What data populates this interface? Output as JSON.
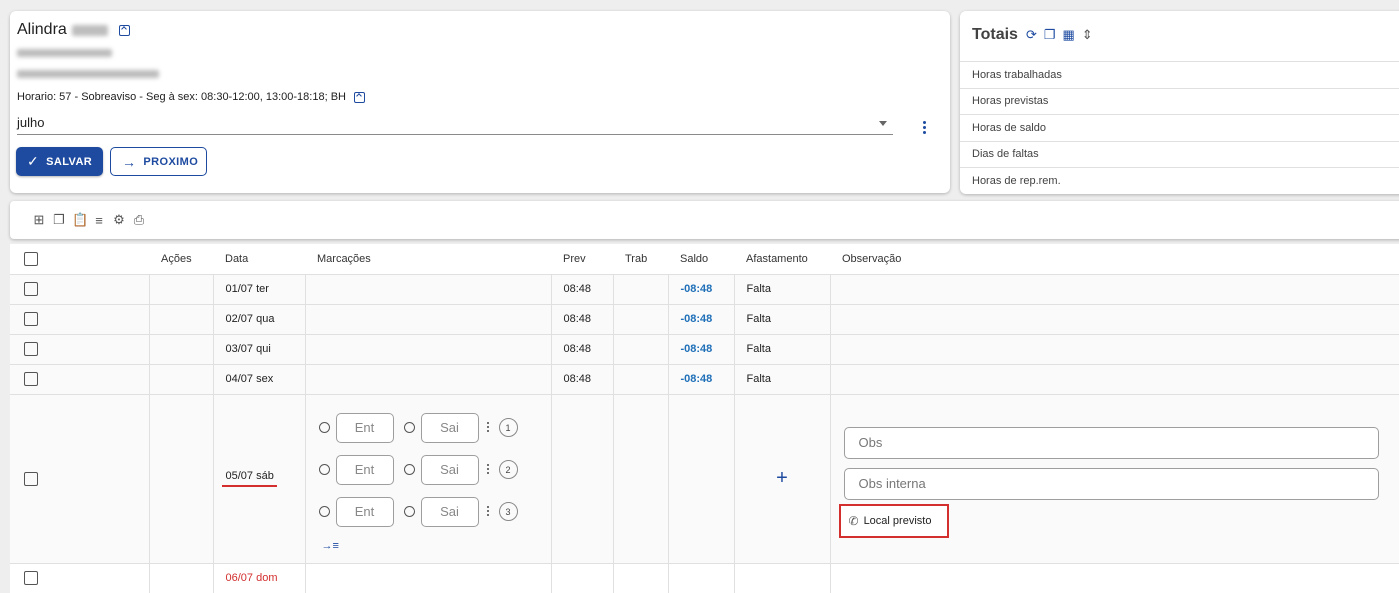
{
  "employee": {
    "name": "Alindra",
    "horario": "Horario: 57 - Sobreaviso - Seg à sex: 08:30-12:00, 13:00-18:18; BH",
    "month": "julho",
    "save_label": "SALVAR",
    "next_label": "PROXIMO"
  },
  "totals": {
    "title": "Totais",
    "rows": [
      "Horas trabalhadas",
      "Horas previstas",
      "Horas de saldo",
      "Dias de faltas",
      "Horas de rep.rem."
    ]
  },
  "table": {
    "headers": {
      "acoes": "Ações",
      "data": "Data",
      "marcacoes": "Marcações",
      "prev": "Prev",
      "trab": "Trab",
      "saldo": "Saldo",
      "afastamento": "Afastamento",
      "observacao": "Observação"
    },
    "rows": [
      {
        "data": "01/07 ter",
        "prev": "08:48",
        "saldo": "-08:48",
        "afastamento": "Falta"
      },
      {
        "data": "02/07 qua",
        "prev": "08:48",
        "saldo": "-08:48",
        "afastamento": "Falta"
      },
      {
        "data": "03/07 qui",
        "prev": "08:48",
        "saldo": "-08:48",
        "afastamento": "Falta"
      },
      {
        "data": "04/07 sex",
        "prev": "08:48",
        "saldo": "-08:48",
        "afastamento": "Falta"
      }
    ],
    "expanded": {
      "data": "05/07 sáb",
      "entry_placeholder": "Ent",
      "exit_placeholder": "Sai",
      "pair_numbers": [
        "1",
        "2",
        "3"
      ],
      "obs_placeholder": "Obs",
      "obs_interna_placeholder": "Obs interna",
      "local": "Local previsto"
    },
    "last_row": {
      "data": "06/07 dom"
    }
  },
  "colors": {
    "primary": "#1e4ba0",
    "saldo": "#1e6fb8",
    "highlight": "#d32f2f"
  }
}
